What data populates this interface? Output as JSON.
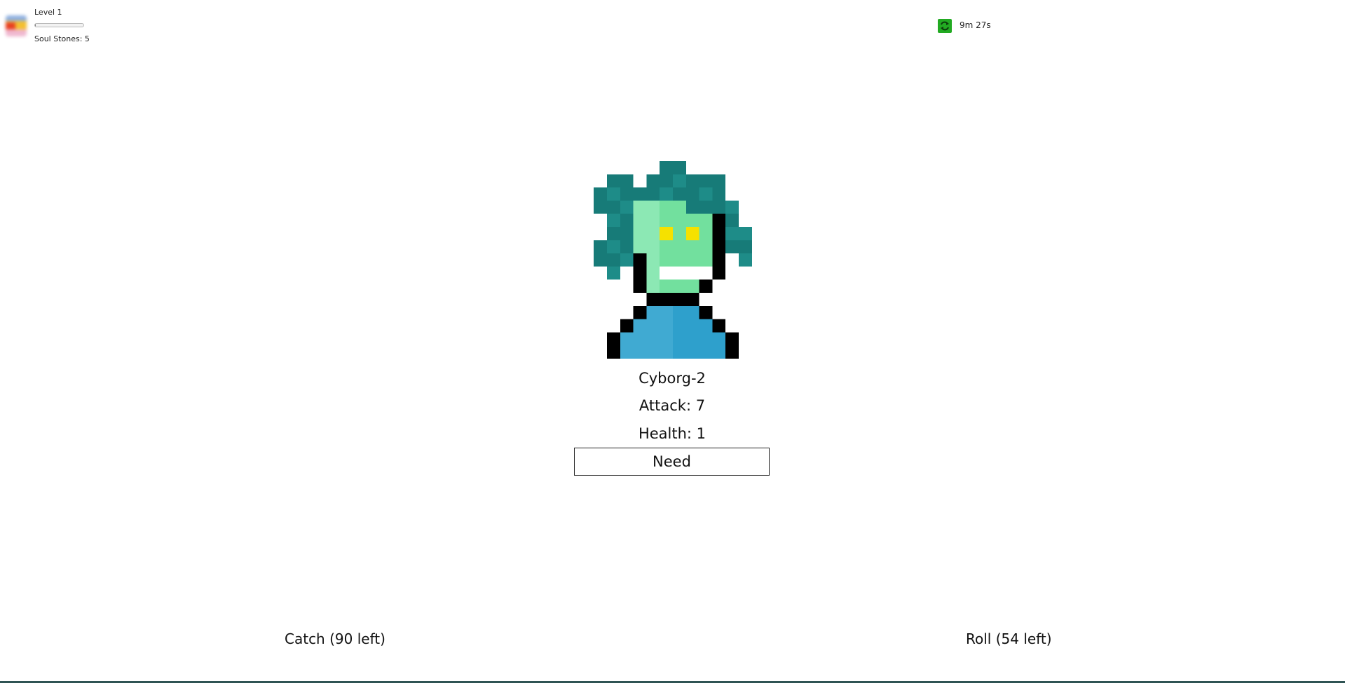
{
  "player": {
    "level_label": "Level 1",
    "xp_progress": 0.02,
    "soul_stones_label": "Soul Stones: 5"
  },
  "timer": {
    "icon": "refresh-icon",
    "icon_color": "#22aa22",
    "text": "9m 27s"
  },
  "creature": {
    "name": "Cyborg-2",
    "attack_label": "Attack: 7",
    "health_label": "Health: 1",
    "need_label": "Need",
    "palette": {
      "hair_dark": "#177b78",
      "hair_light": "#1e8c88",
      "skin_light": "#8ce8b4",
      "skin_dark": "#72e09e",
      "eyes": "#f5e100",
      "mouth": "#ffffff",
      "outline": "#000000",
      "shirt_light": "#40aad2",
      "shirt_dark": "#2ea0cc"
    }
  },
  "actions": {
    "catch_label": "Catch (90 left)",
    "roll_label": "Roll (54 left)"
  }
}
